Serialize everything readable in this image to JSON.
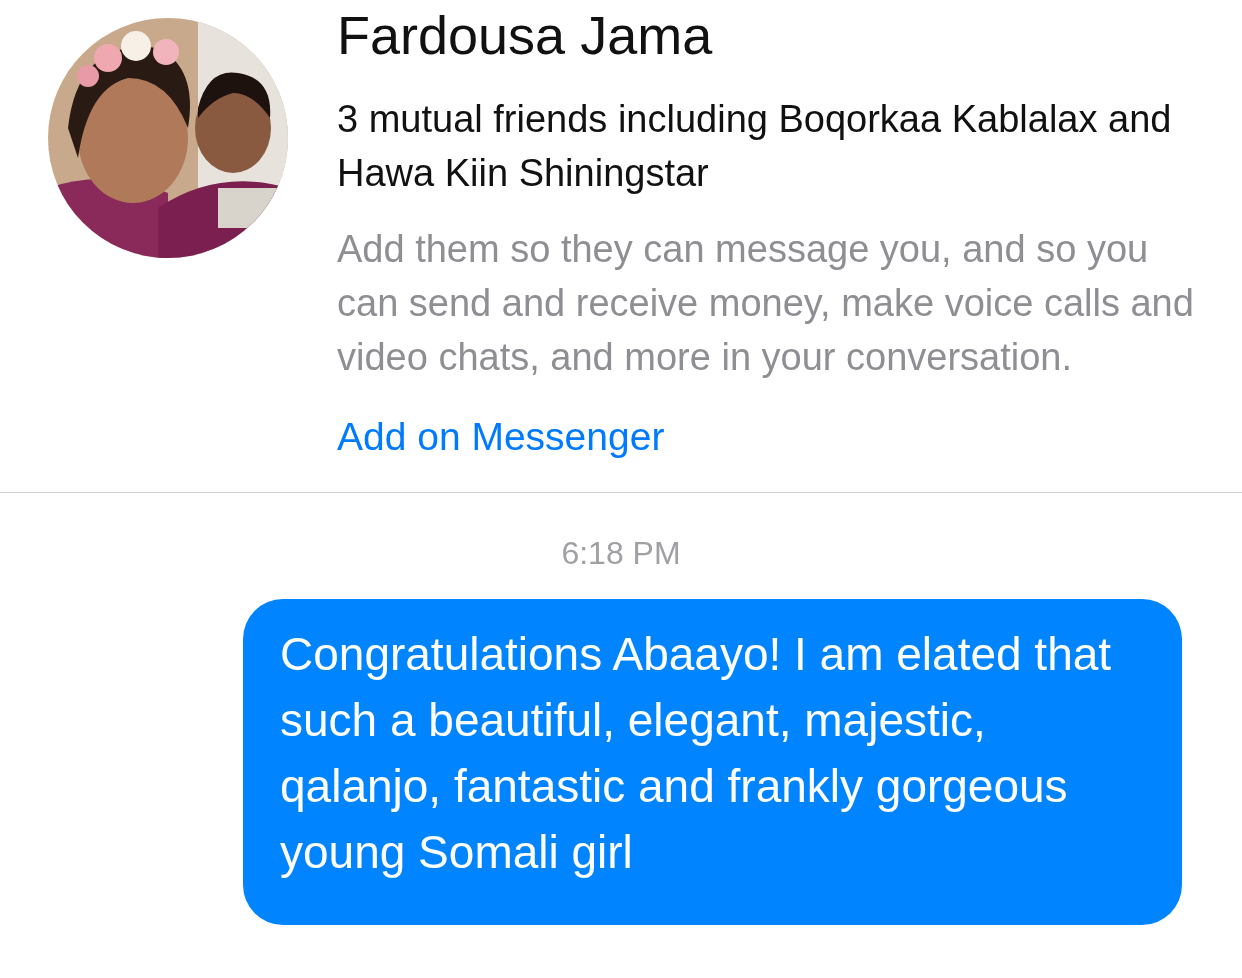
{
  "contact": {
    "name": "Fardousa Jama",
    "mutual_friends": "3 mutual friends including Boqorkaa Kablalax and Hawa Kiin Shiningstar",
    "note": "Add them so they can message you, and so you can send and receive money, make voice calls and video chats, and more in your conversation.",
    "add_link": "Add on Messenger"
  },
  "conversation": {
    "timestamp": "6:18 PM",
    "messages": [
      {
        "kind": "sent",
        "text": "Congratulations Abaayo! I am elated that such a beautiful, elegant, majestic, qalanjo, fantastic and frankly gorgeous young Somali girl"
      }
    ]
  }
}
